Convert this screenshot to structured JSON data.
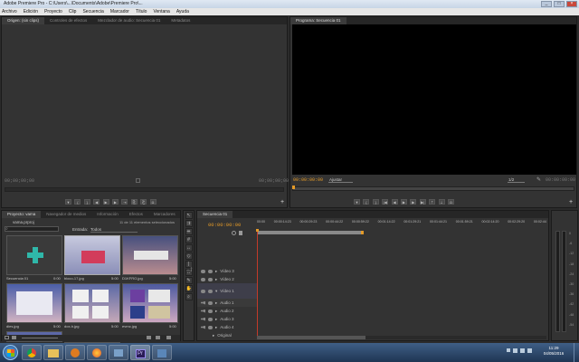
{
  "window": {
    "title": "Adobe Premiere Pro - C:\\Users\\...\\Documents\\Adobe\\Premiere Pro\\...",
    "controls": [
      "_",
      "□",
      "×"
    ]
  },
  "menu": [
    "Archivo",
    "Edición",
    "Proyecto",
    "Clip",
    "Secuencia",
    "Marcador",
    "Título",
    "Ventana",
    "Ayuda"
  ],
  "source_panel": {
    "tabs": [
      "Origen: (sin clips)",
      "Controles de efectos",
      "Mezclador de audio: Secuencia 01",
      "Metadatos"
    ],
    "tc_left": "00;00;00;00",
    "tc_right": "00;00;00;00"
  },
  "program_panel": {
    "tabs": [
      "Programa: Secuencia 01"
    ],
    "tc_left": "00:00:00:00",
    "tc_right": "00:00:00:00",
    "fit": "Ajustar",
    "ratio": "1/2"
  },
  "project_panel": {
    "tabs": [
      "Proyecto: vama",
      "Navegador de medios",
      "Información",
      "Efectos",
      "Marcadores"
    ],
    "project_name": "vama.prproj",
    "count": "11 de 11 elementos seleccionados",
    "inlabel": "Entrada:",
    "inlabel_value": "Todos",
    "items": [
      {
        "name": "Secuencia 01",
        "dur": "0:00"
      },
      {
        "name": "bloco-17.jpg",
        "dur": "5:00"
      },
      {
        "name": "D1KFRO.jpg",
        "dur": "5:00"
      },
      {
        "name": "dies.jpg",
        "dur": "5:00"
      },
      {
        "name": "dox-h.jpg",
        "dur": "5:00"
      },
      {
        "name": "evrnc.jpg",
        "dur": "5:00"
      }
    ]
  },
  "timeline": {
    "tab": "Secuencia 01",
    "timecode": "00:00:00:00",
    "ruler": [
      "00:00",
      "00:00:14:23",
      "00:00:29:23",
      "00:00:44:22",
      "00:00:59:22",
      "00:01:14:22",
      "00:01:29:21",
      "00:01:44:21",
      "00:01:59:21",
      "00:02:14:20",
      "00:02:29:20",
      "00:02:44"
    ],
    "tracks": [
      "Vídeo 3",
      "Vídeo 2",
      "Vídeo 1",
      "Audio 1",
      "Audio 2",
      "Audio 3",
      "Audio 4",
      "Original"
    ]
  },
  "meter_scale": [
    "0",
    "-6",
    "-12",
    "-18",
    "-24",
    "-30",
    "-36",
    "-42",
    "-48",
    "-54"
  ],
  "taskbar": {
    "icons": [
      "windows-start",
      "chrome",
      "folder",
      "media-player",
      "firefox",
      "utility",
      "pdf",
      "photo",
      "premiere"
    ],
    "clock_time": "11:29",
    "clock_date": "04/05/2016"
  },
  "colors": {
    "timecode": "#e39a28",
    "panel": "#333333",
    "accent_video": "#6f7fbf"
  }
}
